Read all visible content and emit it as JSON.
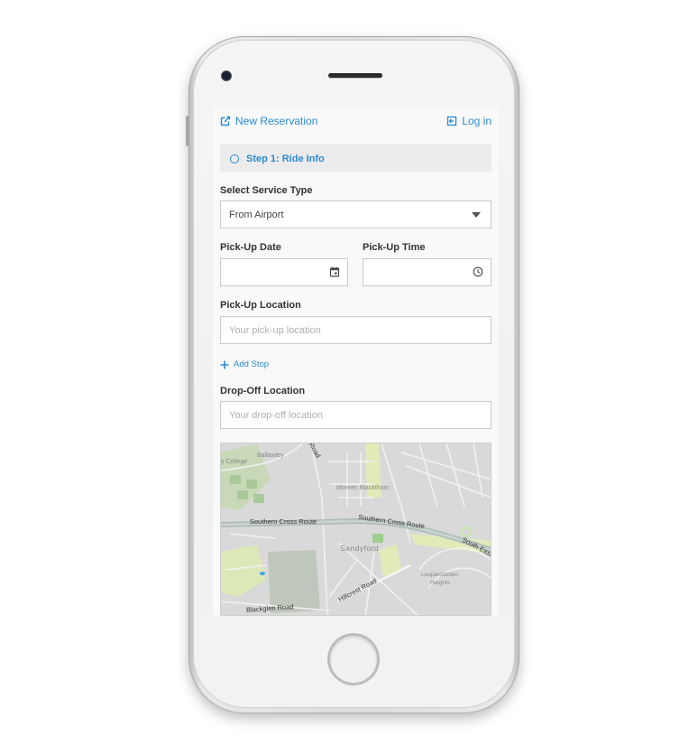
{
  "topbar": {
    "new_reservation": "New Reservation",
    "login": "Log in"
  },
  "step": {
    "label": "Step 1: Ride Info"
  },
  "form": {
    "service_type": {
      "label": "Select Service Type",
      "value": "From Airport"
    },
    "pickup_date": {
      "label": "Pick-Up Date",
      "value": ""
    },
    "pickup_time": {
      "label": "Pick-Up Time",
      "value": ""
    },
    "pickup_location": {
      "label": "Pick-Up Location",
      "placeholder": "Your pick-up location",
      "value": ""
    },
    "add_stop": "Add Stop",
    "dropoff_location": {
      "label": "Drop-Off Location",
      "placeholder": "Your drop-off location",
      "value": ""
    }
  },
  "map": {
    "labels": {
      "college": "y College",
      "ballawley": "Ballawley",
      "road_top": "Road",
      "moreen": "Moreen Blackthorn",
      "scr_left": "Southern Cross Route",
      "scr_right": "Southern Cross Route",
      "south_east": "South East",
      "sandyford": "Sandyford",
      "leopardstown": "Leopardstown",
      "heights": "Heights",
      "hillcrest": "Hillcrest Road",
      "blackglen": "Blackglen Road"
    }
  },
  "colors": {
    "accent": "#2a8ad4",
    "step_bg": "#ececec",
    "screen_bg": "#f9f9f9"
  }
}
